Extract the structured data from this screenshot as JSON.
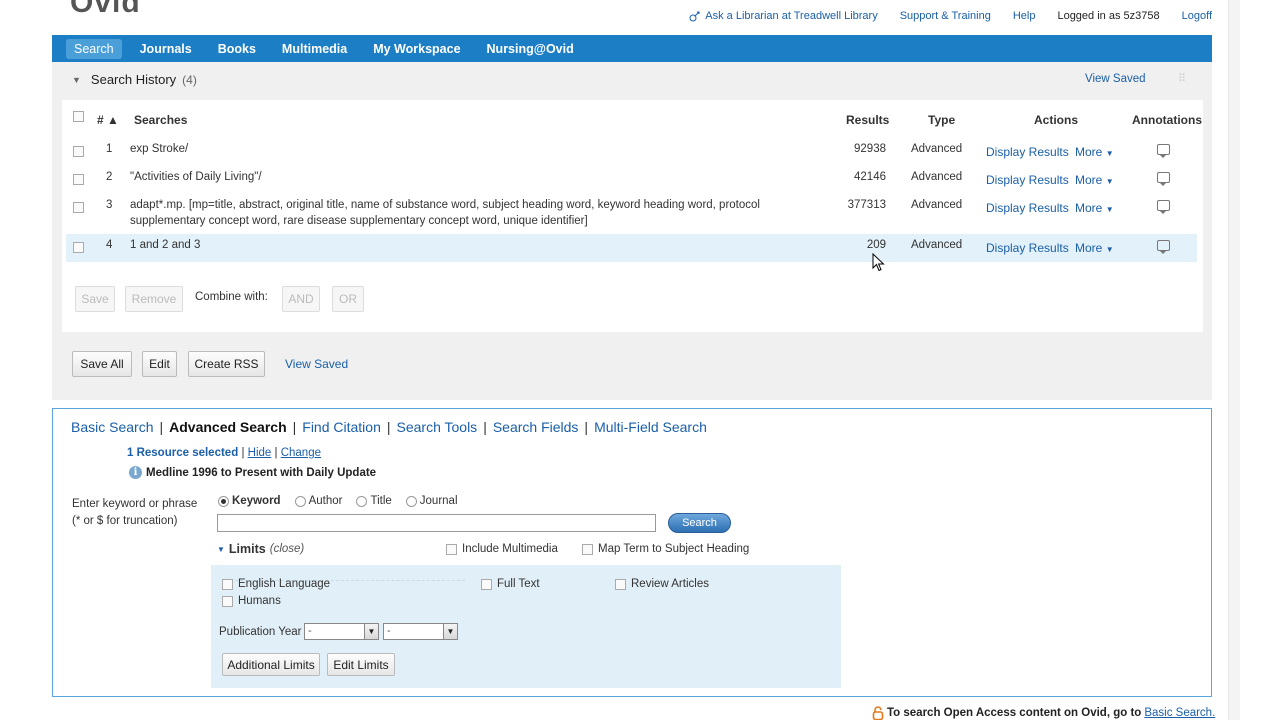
{
  "logo": "Ovid",
  "top_links": {
    "librarian": "Ask a Librarian at Treadwell Library",
    "support": "Support & Training",
    "help": "Help",
    "logged_in": "Logged in as 5z3758",
    "logoff": "Logoff"
  },
  "nav": [
    "Search",
    "Journals",
    "Books",
    "Multimedia",
    "My Workspace",
    "Nursing@Ovid"
  ],
  "history": {
    "title": "Search History",
    "count": "(4)",
    "view_saved": "View Saved",
    "columns": {
      "num": "# ▲",
      "searches": "Searches",
      "results": "Results",
      "type": "Type",
      "actions": "Actions",
      "annotations": "Annotations"
    },
    "rows": [
      {
        "num": "1",
        "query": "exp Stroke/",
        "query2": "",
        "results": "92938",
        "type": "Advanced"
      },
      {
        "num": "2",
        "query": "\"Activities of Daily Living\"/",
        "query2": "",
        "results": "42146",
        "type": "Advanced"
      },
      {
        "num": "3",
        "query": "adapt*.mp. [mp=title, abstract, original title, name of substance word, subject heading word, keyword heading word, protocol",
        "query2": "supplementary concept word, rare disease supplementary concept word, unique identifier]",
        "results": "377313",
        "type": "Advanced"
      },
      {
        "num": "4",
        "query": "1 and 2 and 3",
        "query2": "",
        "results": "209",
        "type": "Advanced"
      }
    ],
    "action_display": "Display Results",
    "action_more": "More",
    "buttons": {
      "save": "Save",
      "remove": "Remove",
      "combine_with": "Combine with:",
      "and": "AND",
      "or": "OR",
      "save_all": "Save All",
      "edit": "Edit",
      "create_rss": "Create RSS",
      "view_saved": "View Saved"
    }
  },
  "search_tabs": [
    "Basic Search",
    "Advanced Search",
    "Find Citation",
    "Search Tools",
    "Search Fields",
    "Multi-Field Search"
  ],
  "resource": {
    "selected": "1 Resource selected",
    "hide": "Hide",
    "change": "Change",
    "database": "Medline 1996 to Present with Daily Update"
  },
  "keyword": {
    "label1": "Enter keyword or phrase",
    "label2": "(* or $ for truncation)",
    "options": [
      "Keyword",
      "Author",
      "Title",
      "Journal"
    ],
    "selected": "Keyword",
    "input_value": "",
    "search_button": "Search"
  },
  "limits": {
    "title": "Limits",
    "close": "(close)",
    "include_multimedia": "Include Multimedia",
    "map_term": "Map Term to Subject Heading",
    "english": "English Language",
    "full_text": "Full Text",
    "review_articles": "Review Articles",
    "humans": "Humans",
    "pub_year": "Publication Year",
    "year_from": "-",
    "year_to": "-",
    "additional_limits": "Additional Limits",
    "edit_limits": "Edit Limits"
  },
  "open_access": {
    "text": "To search Open Access content on Ovid, go to",
    "link": "Basic Search."
  },
  "colors": {
    "nav_bg": "#1c7fc5",
    "link": "#1a5fa8",
    "selected_row": "#e2f1fa",
    "limits_bg": "#e1eff8"
  }
}
